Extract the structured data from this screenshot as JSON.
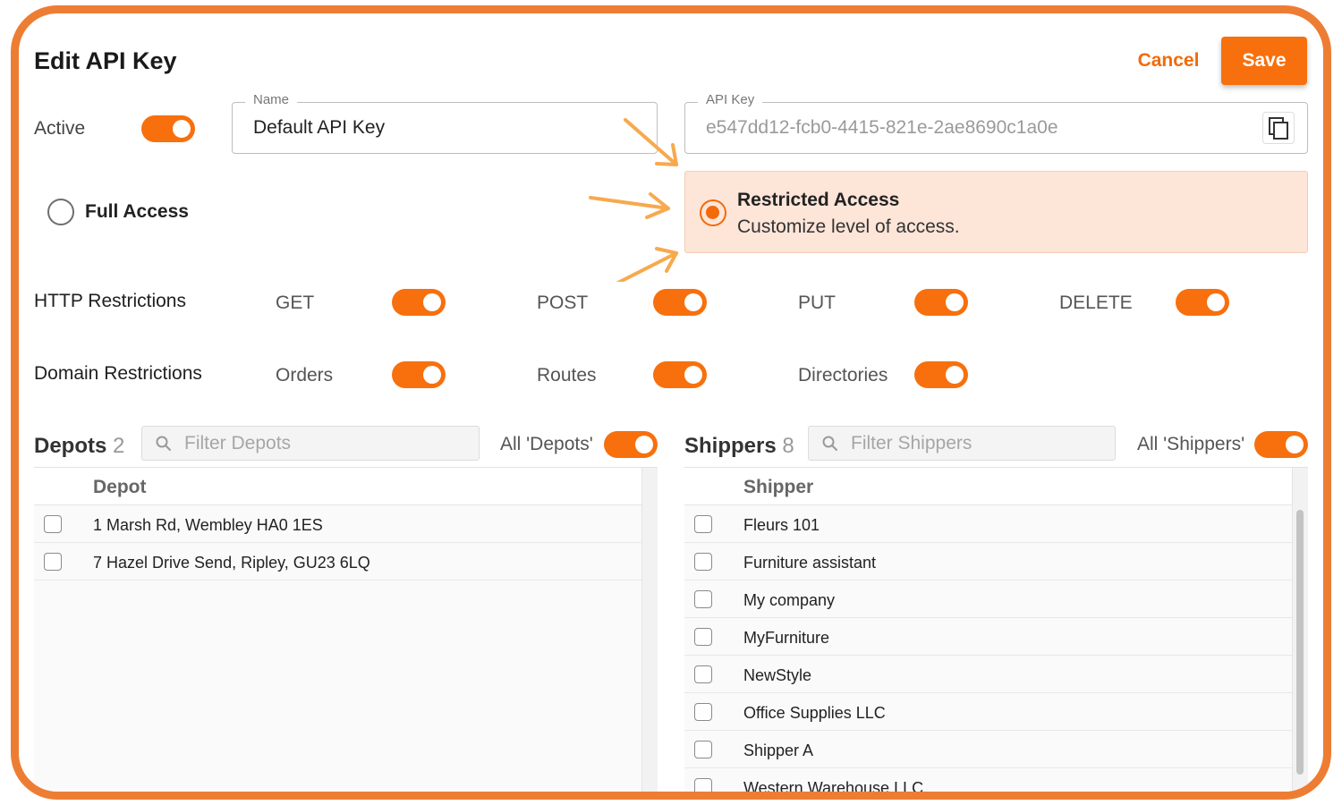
{
  "header": {
    "title": "Edit API Key",
    "cancel_label": "Cancel",
    "save_label": "Save"
  },
  "active": {
    "label": "Active",
    "on": true
  },
  "name_field": {
    "legend": "Name",
    "value": "Default API Key"
  },
  "api_key_field": {
    "legend": "API Key",
    "value": "e547dd12-fcb0-4415-821e-2ae8690c1a0e"
  },
  "access": {
    "full_label": "Full Access",
    "restricted_title": "Restricted Access",
    "restricted_subtitle": "Customize level of access.",
    "selected": "restricted"
  },
  "http_restrictions": {
    "label": "HTTP Restrictions",
    "options": [
      "GET",
      "POST",
      "PUT",
      "DELETE"
    ]
  },
  "domain_restrictions": {
    "label": "Domain Restrictions",
    "options": [
      "Orders",
      "Routes",
      "Directories"
    ]
  },
  "depots": {
    "title": "Depots",
    "count": "2",
    "filter_placeholder": "Filter Depots",
    "all_label": "All 'Depots'",
    "column": "Depot",
    "rows": [
      "1 Marsh Rd, Wembley HA0 1ES",
      "7 Hazel Drive Send, Ripley, GU23 6LQ"
    ]
  },
  "shippers": {
    "title": "Shippers",
    "count": "8",
    "filter_placeholder": "Filter Shippers",
    "all_label": "All 'Shippers'",
    "column": "Shipper",
    "rows": [
      "Fleurs 101",
      "Furniture assistant",
      "My company",
      "MyFurniture",
      "NewStyle",
      "Office Supplies LLC",
      "Shipper A",
      "Western Warehouse LLC"
    ]
  },
  "colors": {
    "accent": "#f7700d",
    "frame": "#ee7d34",
    "highlight_bg": "#fde5d8",
    "arrow": "#f7a94e"
  }
}
